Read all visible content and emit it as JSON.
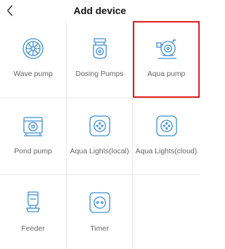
{
  "header": {
    "title": "Add device",
    "back_icon": "chevron-left-icon"
  },
  "colors": {
    "icon": "#3a8fd6",
    "selected_border": "#e11b1b",
    "label": "#666666",
    "divider": "#e9e9ee"
  },
  "devices": [
    {
      "label": "Wave pump",
      "icon": "wave-pump-icon",
      "selected": false
    },
    {
      "label": "Dosing Pumps",
      "icon": "dosing-pump-icon",
      "selected": false
    },
    {
      "label": "Aqua pump",
      "icon": "aqua-pump-icon",
      "selected": true
    },
    {
      "label": "Pond pump",
      "icon": "pond-pump-icon",
      "selected": false
    },
    {
      "label": "Aqua Lights(local)",
      "icon": "aqua-light-icon",
      "selected": false
    },
    {
      "label": "Aqua Lights(cloud)",
      "icon": "aqua-light-icon",
      "selected": false
    },
    {
      "label": "Feeder",
      "icon": "feeder-icon",
      "selected": false
    },
    {
      "label": "Timer",
      "icon": "timer-icon",
      "selected": false
    }
  ]
}
